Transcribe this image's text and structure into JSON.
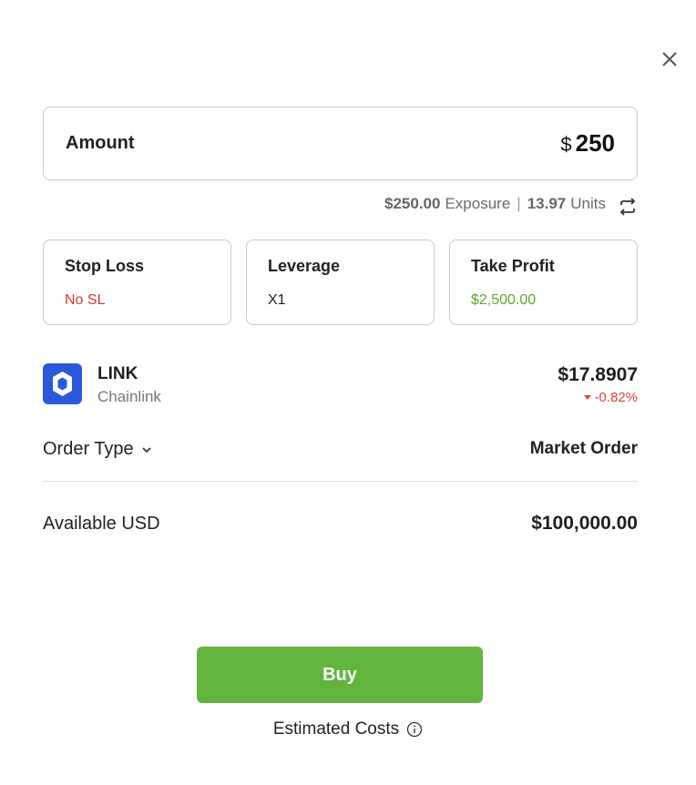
{
  "amount": {
    "label": "Amount",
    "currency_symbol": "$",
    "value": "250"
  },
  "exposure": {
    "exposure_value": "$250.00",
    "exposure_label": "Exposure",
    "separator": "|",
    "units_value": "13.97",
    "units_label": "Units"
  },
  "params": [
    {
      "title": "Stop Loss",
      "value": "No SL",
      "color": "#d0392f"
    },
    {
      "title": "Leverage",
      "value": "X1",
      "color": "#222222"
    },
    {
      "title": "Take Profit",
      "value": "$2,500.00",
      "color": "#5aaa2e"
    }
  ],
  "asset": {
    "symbol": "LINK",
    "name": "Chainlink",
    "price": "$17.8907",
    "change": "-0.82%",
    "logo_color": "#2a5ada"
  },
  "order": {
    "label": "Order Type",
    "value": "Market Order"
  },
  "available": {
    "label": "Available USD",
    "value": "$100,000.00"
  },
  "buy": {
    "label": "Buy",
    "color": "#62b43f"
  },
  "estimated_costs": {
    "label": "Estimated Costs"
  },
  "icons": {
    "close": "close-icon",
    "swap": "swap-icon",
    "chevron": "chevron-down-icon",
    "info": "info-icon",
    "logo": "chainlink-logo-icon"
  }
}
